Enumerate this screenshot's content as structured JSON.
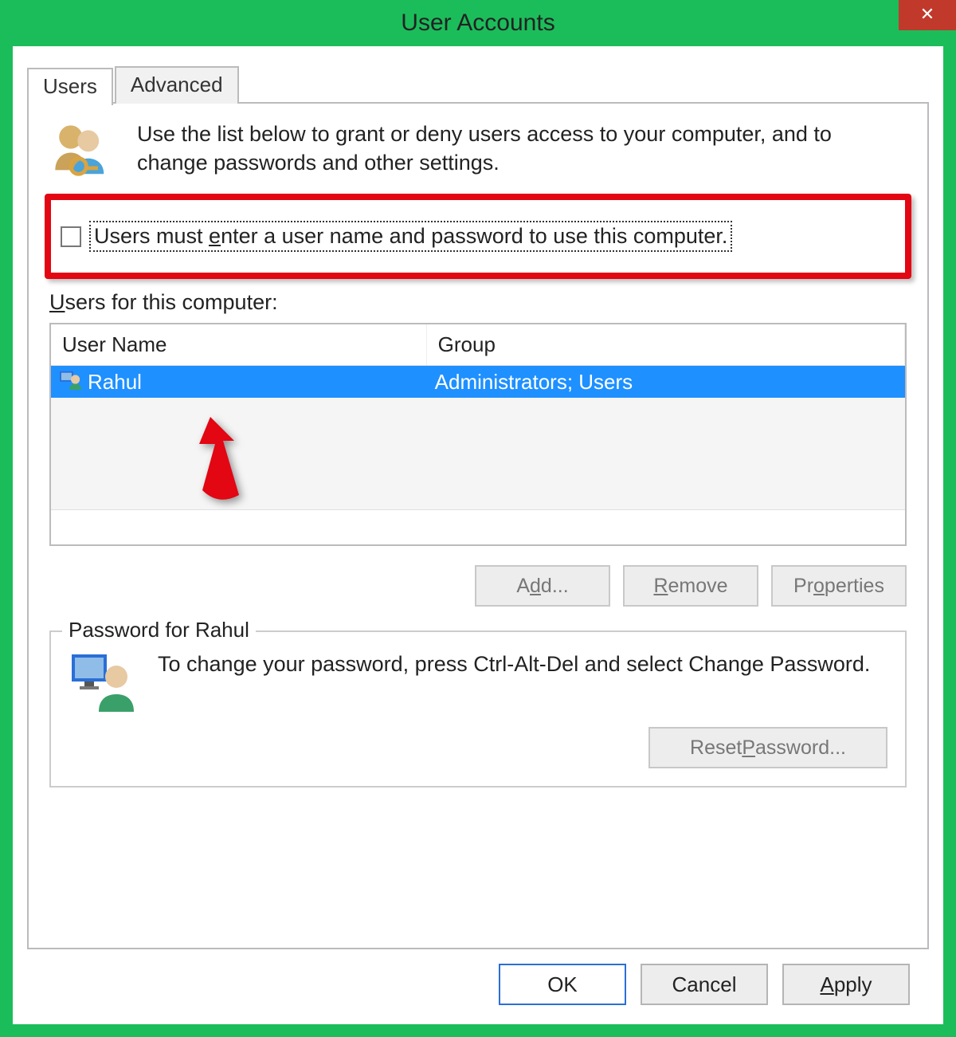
{
  "window": {
    "title": "User Accounts",
    "close_glyph": "✕"
  },
  "tabs": {
    "users": "Users",
    "advanced": "Advanced"
  },
  "intro": "Use the list below to grant or deny users access to your computer, and to change passwords and other settings.",
  "checkbox_label_pre": "Users must ",
  "checkbox_label_ul": "e",
  "checkbox_label_mid": "nter a user name and password to use this computer.",
  "list_label_ul": "U",
  "list_label_rest": "sers for this computer:",
  "columns": {
    "name": "User Name",
    "group": "Group"
  },
  "rows": [
    {
      "name": "Rahul",
      "group": "Administrators; Users"
    }
  ],
  "buttons": {
    "add_pre": "A",
    "add_ul": "d",
    "add_post": "d...",
    "remove_ul": "R",
    "remove_post": "emove",
    "props_pre": "Pr",
    "props_ul": "o",
    "props_post": "perties"
  },
  "password_section": {
    "legend": "Password for Rahul",
    "text": "To change your password, press Ctrl-Alt-Del and select Change Password.",
    "reset_pre": "Reset ",
    "reset_ul": "P",
    "reset_post": "assword..."
  },
  "dialog_buttons": {
    "ok": "OK",
    "cancel": "Cancel",
    "apply_ul": "A",
    "apply_post": "pply"
  }
}
